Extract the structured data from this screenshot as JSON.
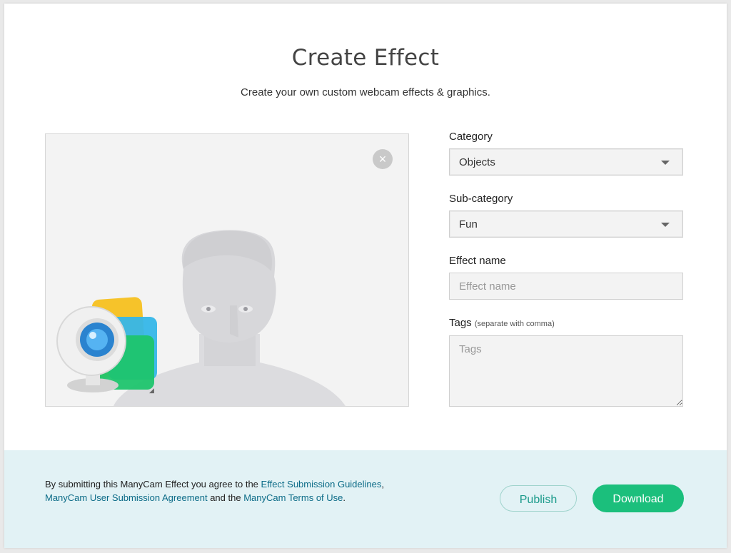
{
  "header": {
    "title": "Create Effect",
    "subtitle": "Create your own custom webcam effects & graphics."
  },
  "preview": {
    "close_symbol": "×",
    "icons": [
      "silhouette-placeholder",
      "manycam-logo-icon",
      "close-icon"
    ]
  },
  "form": {
    "category": {
      "label": "Category",
      "value": "Objects"
    },
    "subcategory": {
      "label": "Sub-category",
      "value": "Fun"
    },
    "effect_name": {
      "label": "Effect name",
      "placeholder": "Effect name",
      "value": ""
    },
    "tags": {
      "label": "Tags",
      "hint": "(separate with comma)",
      "placeholder": "Tags",
      "value": ""
    }
  },
  "footer": {
    "text_1": "By submitting this ManyCam Effect you agree to the ",
    "link_guidelines": "Effect Submission Guidelines",
    "text_2": ",",
    "link_agreement": "ManyCam User Submission Agreement",
    "text_3": " and the ",
    "link_terms": "ManyCam Terms of Use",
    "text_4": ".",
    "publish_label": "Publish",
    "download_label": "Download"
  },
  "colors": {
    "accent_green": "#1bbf7c",
    "publish_teal": "#1a9a8a",
    "link_blue": "#0b6b87",
    "footer_bg": "#e2f2f5"
  }
}
